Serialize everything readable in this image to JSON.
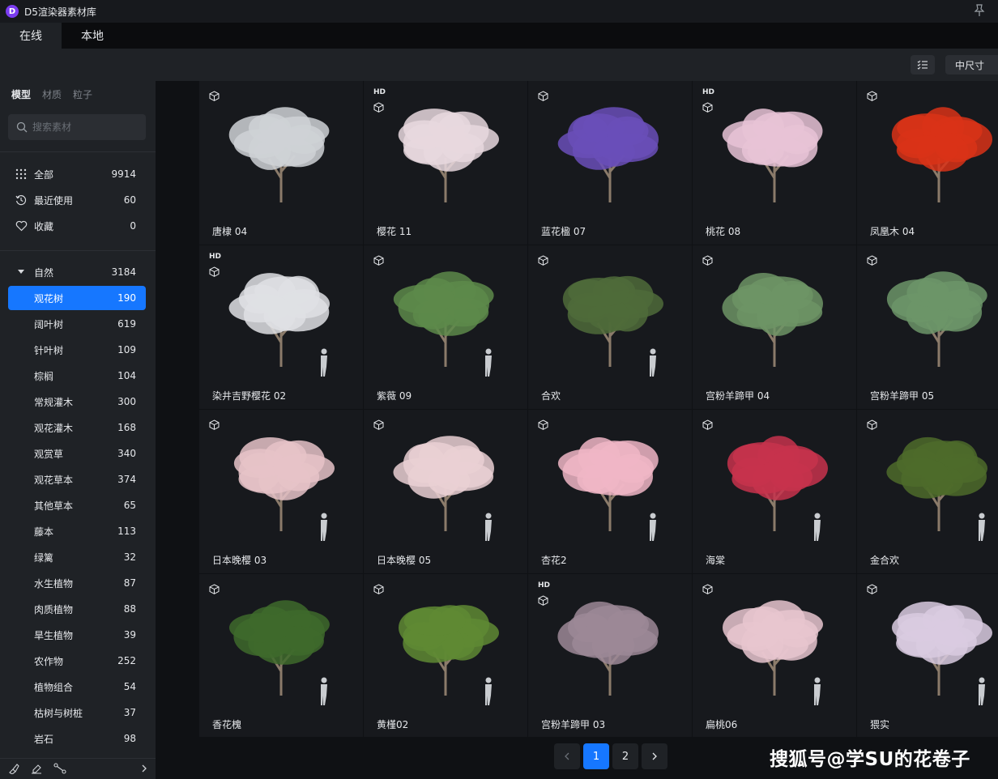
{
  "app": {
    "title": "D5渲染器素材库",
    "logo_letter": "D"
  },
  "tabs": [
    {
      "label": "在线",
      "active": true
    },
    {
      "label": "本地",
      "active": false
    }
  ],
  "toolbar": {
    "size_label": "中尺寸"
  },
  "sidebar": {
    "category_tabs": [
      {
        "label": "模型",
        "active": true
      },
      {
        "label": "材质",
        "active": false
      },
      {
        "label": "粒子",
        "active": false
      }
    ],
    "search": {
      "placeholder": "搜索素材",
      "value": ""
    },
    "top_items": [
      {
        "icon": "grid-dots-icon",
        "label": "全部",
        "count": "9914"
      },
      {
        "icon": "history-icon",
        "label": "最近使用",
        "count": "60"
      },
      {
        "icon": "heart-icon",
        "label": "收藏",
        "count": "0"
      }
    ],
    "group": {
      "label": "自然",
      "count": "3184",
      "expanded": true
    },
    "sub_items": [
      {
        "label": "观花树",
        "count": "190",
        "active": true
      },
      {
        "label": "阔叶树",
        "count": "619"
      },
      {
        "label": "针叶树",
        "count": "109"
      },
      {
        "label": "棕榈",
        "count": "104"
      },
      {
        "label": "常规灌木",
        "count": "300"
      },
      {
        "label": "观花灌木",
        "count": "168"
      },
      {
        "label": "观赏草",
        "count": "340"
      },
      {
        "label": "观花草本",
        "count": "374"
      },
      {
        "label": "其他草本",
        "count": "65"
      },
      {
        "label": "藤本",
        "count": "113"
      },
      {
        "label": "绿篱",
        "count": "32"
      },
      {
        "label": "水生植物",
        "count": "87"
      },
      {
        "label": "肉质植物",
        "count": "88"
      },
      {
        "label": "旱生植物",
        "count": "39"
      },
      {
        "label": "农作物",
        "count": "252"
      },
      {
        "label": "植物组合",
        "count": "54"
      },
      {
        "label": "枯树与树桩",
        "count": "37"
      },
      {
        "label": "岩石",
        "count": "98"
      }
    ]
  },
  "assets": [
    {
      "name": "唐棣 04",
      "hd": false,
      "color": "#cfd2d6",
      "human": false
    },
    {
      "name": "樱花 11",
      "hd": true,
      "color": "#e8d8de",
      "human": false
    },
    {
      "name": "蓝花楹 07",
      "hd": false,
      "color": "#6a4fb8",
      "human": false
    },
    {
      "name": "桃花 08",
      "hd": true,
      "color": "#e7c3d6",
      "human": false
    },
    {
      "name": "凤凰木 04",
      "hd": false,
      "color": "#d93318",
      "human": false
    },
    {
      "name": "染井吉野樱花 02",
      "hd": true,
      "color": "#dfe1e4",
      "human": true
    },
    {
      "name": "紫薇 09",
      "hd": false,
      "color": "#5d8a4a",
      "human": true
    },
    {
      "name": "合欢",
      "hd": false,
      "color": "#4f6b3a",
      "human": true
    },
    {
      "name": "宫粉羊蹄甲 04",
      "hd": false,
      "color": "#6d9465",
      "human": false
    },
    {
      "name": "宫粉羊蹄甲 05",
      "hd": false,
      "color": "#6c9568",
      "human": false
    },
    {
      "name": "日本晚樱 03",
      "hd": false,
      "color": "#e6c3c8",
      "human": true
    },
    {
      "name": "日本晚樱 05",
      "hd": false,
      "color": "#ead0d3",
      "human": true
    },
    {
      "name": "杏花2",
      "hd": false,
      "color": "#f0b6c6",
      "human": true
    },
    {
      "name": "海棠",
      "hd": false,
      "color": "#c7334c",
      "human": true
    },
    {
      "name": "金合欢",
      "hd": false,
      "color": "#4d6b2a",
      "human": true
    },
    {
      "name": "香花槐",
      "hd": false,
      "color": "#3e6a2c",
      "human": true
    },
    {
      "name": "黄槿02",
      "hd": false,
      "color": "#5f8a34",
      "human": true
    },
    {
      "name": "宫粉羊蹄甲 03",
      "hd": true,
      "color": "#9c8896",
      "human": false
    },
    {
      "name": "扁桃06",
      "hd": false,
      "color": "#e7c6cf",
      "human": true
    },
    {
      "name": "猥实",
      "hd": false,
      "color": "#d9cbe0",
      "human": true
    }
  ],
  "pagination": {
    "pages": [
      "1",
      "2"
    ],
    "current": "1"
  },
  "watermark": "搜狐号@学SU的花卷子",
  "colors": {
    "accent": "#1677ff",
    "background": "#0f1114",
    "panel": "#1f2226"
  }
}
